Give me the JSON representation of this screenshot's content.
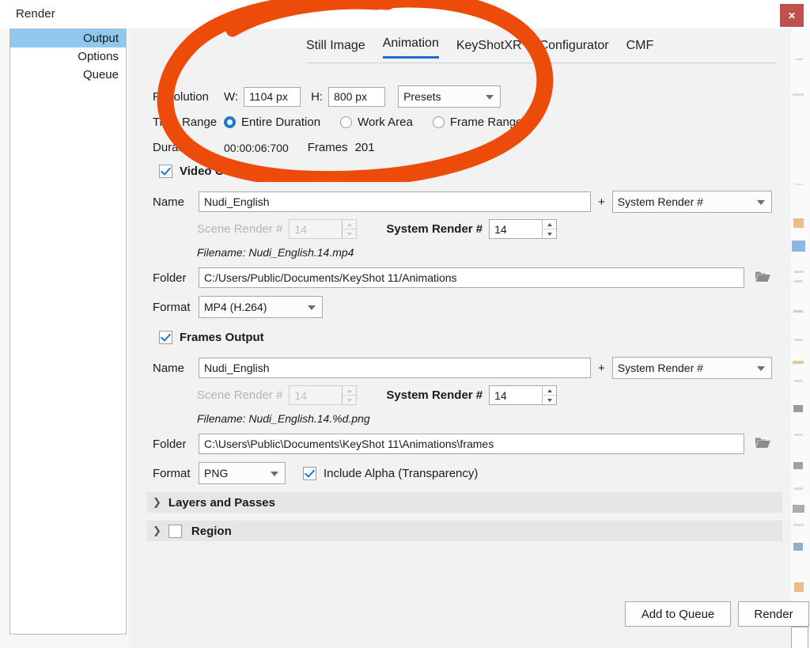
{
  "window": {
    "title": "Render",
    "close_label": "✕"
  },
  "sidebar": {
    "items": [
      {
        "label": "Output",
        "active": true
      },
      {
        "label": "Options",
        "active": false
      },
      {
        "label": "Queue",
        "active": false
      }
    ]
  },
  "tabs": [
    {
      "label": "Still Image",
      "active": false
    },
    {
      "label": "Animation",
      "active": true
    },
    {
      "label": "KeyShotXR",
      "active": false
    },
    {
      "label": "Configurator",
      "active": false
    },
    {
      "label": "CMF",
      "active": false
    }
  ],
  "resolution": {
    "label": "Resolution",
    "width_label": "W:",
    "width_value": "1104 px",
    "height_label": "H:",
    "height_value": "800 px",
    "presets_value": "Presets"
  },
  "time_range": {
    "label": "Time Range",
    "options": [
      {
        "label": "Entire Duration",
        "selected": true
      },
      {
        "label": "Work Area",
        "selected": false
      },
      {
        "label": "Frame Range",
        "selected": false
      }
    ]
  },
  "duration": {
    "label": "Duration",
    "value": "00:00:06:700",
    "frames_label": "Frames",
    "frames_value": "201"
  },
  "video_output": {
    "title": "Video Output",
    "enabled": true,
    "name_label": "Name",
    "name_value": "Nudi_English",
    "plus": "+",
    "suffix_value": "System Render #",
    "scene_render_label": "Scene Render #",
    "scene_render_value": "14",
    "system_render_label": "System Render #",
    "system_render_value": "14",
    "filename_text": "Filename: Nudi_English.14.mp4",
    "folder_label": "Folder",
    "folder_value": "C:/Users/Public/Documents/KeyShot 11/Animations",
    "format_label": "Format",
    "format_value": "MP4 (H.264)"
  },
  "frames_output": {
    "title": "Frames Output",
    "enabled": true,
    "name_label": "Name",
    "name_value": "Nudi_English",
    "plus": "+",
    "suffix_value": "System Render #",
    "scene_render_label": "Scene Render #",
    "scene_render_value": "14",
    "system_render_label": "System Render #",
    "system_render_value": "14",
    "filename_text": "Filename: Nudi_English.14.%d.png",
    "folder_label": "Folder",
    "folder_value": "C:\\Users\\Public\\Documents\\KeyShot 11\\Animations\\frames",
    "format_label": "Format",
    "format_value": "PNG",
    "alpha_label": "Include Alpha (Transparency)",
    "alpha_enabled": true
  },
  "sections": [
    {
      "label": "Layers and Passes",
      "chevron": "❯",
      "has_checkbox": false
    },
    {
      "label": "Region",
      "chevron": "❯",
      "has_checkbox": true,
      "checked": false
    }
  ],
  "footer": {
    "add_to_queue_label": "Add to Queue",
    "render_label": "Render"
  },
  "annotation": {
    "shape": "hand-drawn-ellipse",
    "color": "#ED4B0A"
  },
  "colors": {
    "accent_blue": "#1a6fc4",
    "selection_blue": "#8fc8ee",
    "close_red": "#c0504d",
    "annotation_orange": "#ED4B0A",
    "panel_bg": "#f2f2f2"
  }
}
